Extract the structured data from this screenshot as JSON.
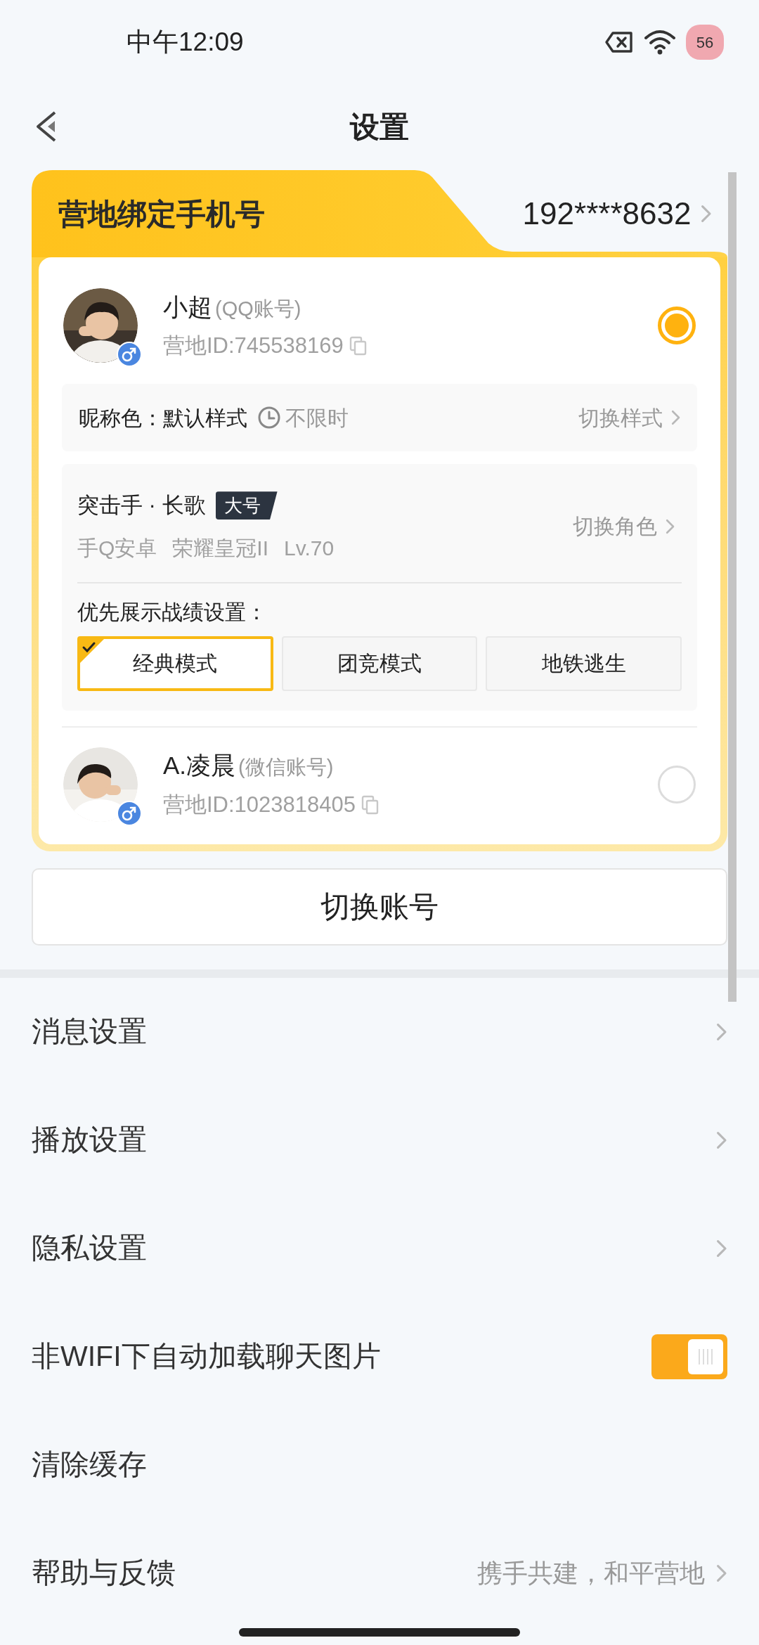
{
  "status_bar": {
    "time": "中午12:09",
    "battery": "56"
  },
  "header": {
    "title": "设置"
  },
  "binding": {
    "label": "营地绑定手机号",
    "phone": "192****8632"
  },
  "accounts": [
    {
      "name": "小超",
      "type": "(QQ账号)",
      "id": "营地ID:745538169",
      "selected": true
    },
    {
      "name": "A.凌晨",
      "type": "(微信账号)",
      "id": "营地ID:1023818405",
      "selected": false
    }
  ],
  "nickname": {
    "label": "昵称色：",
    "value": "默认样式",
    "duration": "不限时",
    "action": "切换样式"
  },
  "role": {
    "name": "突击手 · 长歌",
    "tag": "大号",
    "details": [
      "手Q安卓",
      "荣耀皇冠II",
      "Lv.70"
    ],
    "action": "切换角色",
    "priority_label": "优先展示战绩设置：",
    "modes": [
      {
        "label": "经典模式",
        "selected": true
      },
      {
        "label": "团竞模式",
        "selected": false
      },
      {
        "label": "地铁逃生",
        "selected": false
      }
    ]
  },
  "switch_button": "切换账号",
  "menu": [
    {
      "kind": "link",
      "label": "消息设置"
    },
    {
      "kind": "link",
      "label": "播放设置"
    },
    {
      "kind": "link",
      "label": "隐私设置"
    },
    {
      "kind": "toggle",
      "label": "非WIFI下自动加载聊天图片",
      "on": true
    },
    {
      "kind": "plain",
      "label": "清除缓存"
    },
    {
      "kind": "link",
      "label": "帮助与反馈",
      "value": "携手共建，和平营地"
    }
  ]
}
